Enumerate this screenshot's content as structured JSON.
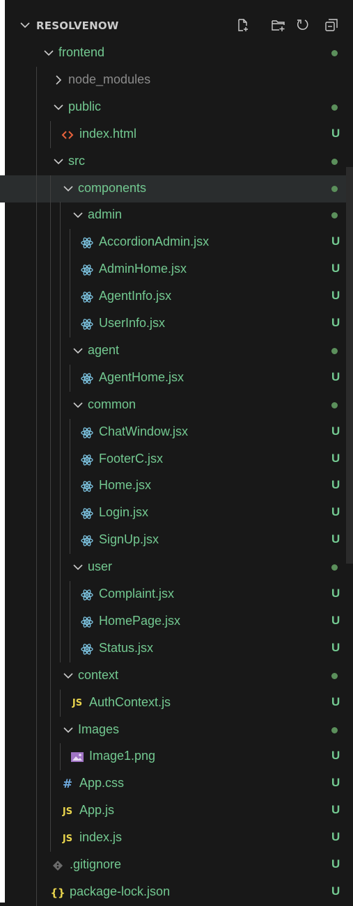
{
  "explorer": {
    "title": "RESOLVENOW",
    "actions": [
      "new-file-icon",
      "new-folder-icon",
      "refresh-icon",
      "collapse-all-icon"
    ]
  },
  "tree": [
    {
      "label": "frontend",
      "kind": "folder",
      "open": true,
      "depth": 0,
      "status": "dot",
      "color": "#73c991"
    },
    {
      "label": "node_modules",
      "kind": "folder",
      "open": false,
      "depth": 1,
      "status": "",
      "color": "#8b8b8b"
    },
    {
      "label": "public",
      "kind": "folder",
      "open": true,
      "depth": 1,
      "status": "dot",
      "color": "#73c991"
    },
    {
      "label": "index.html",
      "kind": "html",
      "depth": 2,
      "status": "U",
      "color": "#73c991"
    },
    {
      "label": "src",
      "kind": "folder",
      "open": true,
      "depth": 1,
      "status": "dot",
      "color": "#73c991"
    },
    {
      "label": "components",
      "kind": "folder",
      "open": true,
      "depth": 2,
      "status": "dot",
      "color": "#73c991",
      "selected": true
    },
    {
      "label": "admin",
      "kind": "folder",
      "open": true,
      "depth": 3,
      "status": "dot",
      "color": "#73c991"
    },
    {
      "label": "AccordionAdmin.jsx",
      "kind": "react",
      "depth": 4,
      "status": "U",
      "color": "#73c991"
    },
    {
      "label": "AdminHome.jsx",
      "kind": "react",
      "depth": 4,
      "status": "U",
      "color": "#73c991"
    },
    {
      "label": "AgentInfo.jsx",
      "kind": "react",
      "depth": 4,
      "status": "U",
      "color": "#73c991"
    },
    {
      "label": "UserInfo.jsx",
      "kind": "react",
      "depth": 4,
      "status": "U",
      "color": "#73c991"
    },
    {
      "label": "agent",
      "kind": "folder",
      "open": true,
      "depth": 3,
      "status": "dot",
      "color": "#73c991"
    },
    {
      "label": "AgentHome.jsx",
      "kind": "react",
      "depth": 4,
      "status": "U",
      "color": "#73c991"
    },
    {
      "label": "common",
      "kind": "folder",
      "open": true,
      "depth": 3,
      "status": "dot",
      "color": "#73c991"
    },
    {
      "label": "ChatWindow.jsx",
      "kind": "react",
      "depth": 4,
      "status": "U",
      "color": "#73c991"
    },
    {
      "label": "FooterC.jsx",
      "kind": "react",
      "depth": 4,
      "status": "U",
      "color": "#73c991"
    },
    {
      "label": "Home.jsx",
      "kind": "react",
      "depth": 4,
      "status": "U",
      "color": "#73c991"
    },
    {
      "label": "Login.jsx",
      "kind": "react",
      "depth": 4,
      "status": "U",
      "color": "#73c991"
    },
    {
      "label": "SignUp.jsx",
      "kind": "react",
      "depth": 4,
      "status": "U",
      "color": "#73c991"
    },
    {
      "label": "user",
      "kind": "folder",
      "open": true,
      "depth": 3,
      "status": "dot",
      "color": "#73c991"
    },
    {
      "label": "Complaint.jsx",
      "kind": "react",
      "depth": 4,
      "status": "U",
      "color": "#73c991"
    },
    {
      "label": "HomePage.jsx",
      "kind": "react",
      "depth": 4,
      "status": "U",
      "color": "#73c991"
    },
    {
      "label": "Status.jsx",
      "kind": "react",
      "depth": 4,
      "status": "U",
      "color": "#73c991"
    },
    {
      "label": "context",
      "kind": "folder",
      "open": true,
      "depth": 2,
      "status": "dot",
      "color": "#73c991"
    },
    {
      "label": "AuthContext.js",
      "kind": "js",
      "depth": 3,
      "status": "U",
      "color": "#73c991"
    },
    {
      "label": "Images",
      "kind": "folder",
      "open": true,
      "depth": 2,
      "status": "dot",
      "color": "#73c991"
    },
    {
      "label": "Image1.png",
      "kind": "image",
      "depth": 3,
      "status": "U",
      "color": "#73c991"
    },
    {
      "label": "App.css",
      "kind": "css",
      "depth": 2,
      "status": "U",
      "color": "#73c991"
    },
    {
      "label": "App.js",
      "kind": "js",
      "depth": 2,
      "status": "U",
      "color": "#73c991"
    },
    {
      "label": "index.js",
      "kind": "js",
      "depth": 2,
      "status": "U",
      "color": "#73c991"
    },
    {
      "label": ".gitignore",
      "kind": "git",
      "depth": 1,
      "status": "U",
      "color": "#73c991"
    },
    {
      "label": "package-lock.json",
      "kind": "json",
      "depth": 1,
      "status": "U",
      "color": "#73c991"
    }
  ]
}
